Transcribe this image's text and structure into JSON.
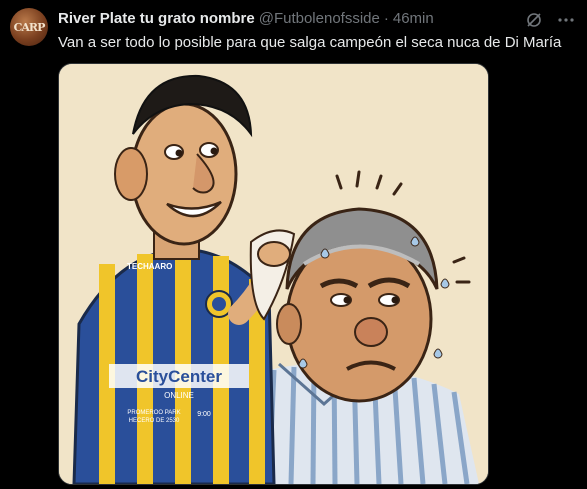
{
  "tweet": {
    "display_name": "River Plate tu grato nombre",
    "handle": "@Futbolenofsside",
    "separator": "·",
    "time": "46min",
    "text": "Van a ser todo lo posible para que salga campeón el seca nuca de Di María",
    "avatar_monogram": "CARP"
  },
  "icons": {
    "grok": "grok-icon",
    "more": "more-options-icon"
  },
  "media": {
    "jersey_text_1": "TECHAARO",
    "jersey_text_2": "CityCenter",
    "jersey_text_3": "ONLINE",
    "jersey_text_4": "PROMEROO PARK",
    "jersey_text_5": "HECERO DE 2530",
    "jersey_text_6": "9:00",
    "colors": {
      "background": "#f1e4c8",
      "jersey_blue": "#2a4f9a",
      "jersey_yellow": "#f0c52a",
      "shirt_stripe": "#8aa6c8"
    }
  }
}
